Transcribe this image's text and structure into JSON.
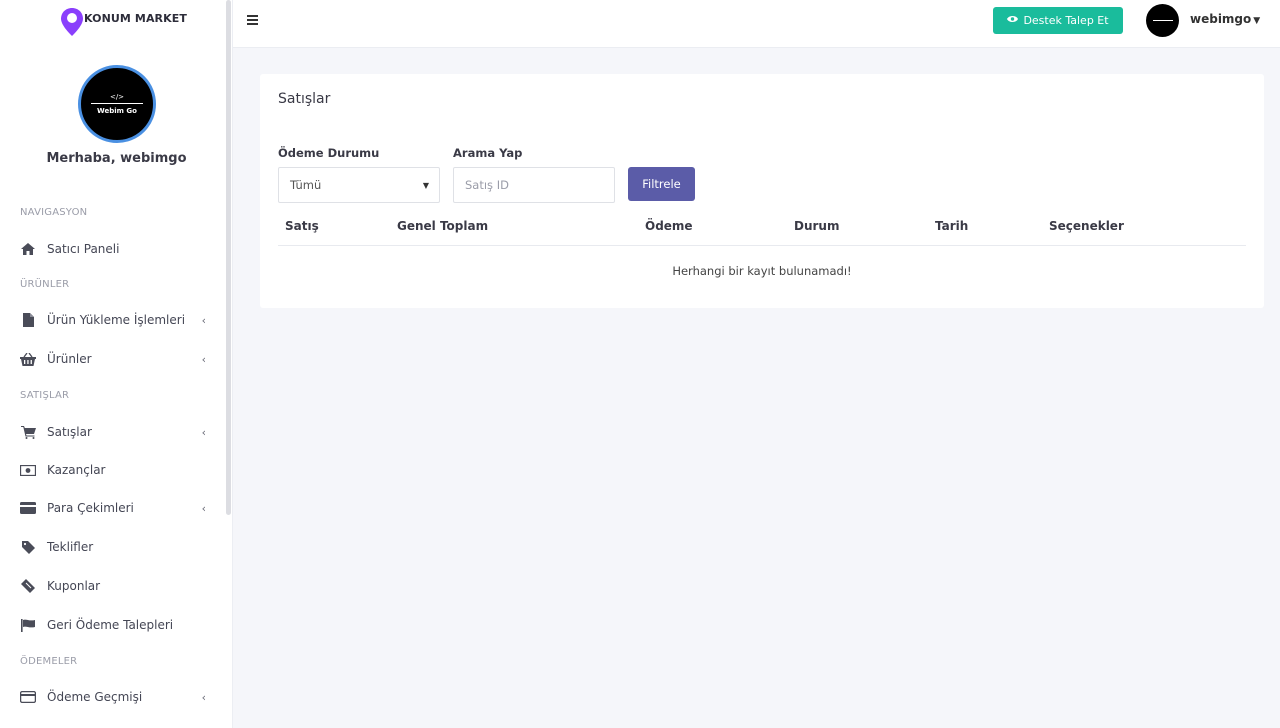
{
  "brand": {
    "logo_text": "KONUM MARKET",
    "pin_color": "#8a3ffc"
  },
  "profile": {
    "avatar_text": "Webim Go",
    "greeting": "Merhaba, webimgo"
  },
  "sidebar": {
    "sections": {
      "nav": "NAVIGASYON",
      "products": "ÜRÜNLER",
      "sales": "SATIŞLAR",
      "payments": "ÖDEMELER"
    },
    "items": {
      "dashboard": {
        "label": "Satıcı Paneli",
        "icon": "home-icon"
      },
      "upload": {
        "label": "Ürün Yükleme İşlemleri",
        "icon": "file-icon"
      },
      "products": {
        "label": "Ürünler",
        "icon": "basket-icon"
      },
      "sales": {
        "label": "Satışlar",
        "icon": "cart-icon"
      },
      "earnings": {
        "label": "Kazançlar",
        "icon": "money-icon"
      },
      "withdrawals": {
        "label": "Para Çekimleri",
        "icon": "credit-card-icon"
      },
      "offers": {
        "label": "Teklifler",
        "icon": "tag-icon"
      },
      "coupons": {
        "label": "Kuponlar",
        "icon": "ticket-icon"
      },
      "refunds": {
        "label": "Geri Ödeme Talepleri",
        "icon": "flag-icon"
      },
      "payment_history": {
        "label": "Ödeme Geçmişi",
        "icon": "credit-card-icon"
      }
    }
  },
  "topbar": {
    "support_label": "Destek Talep Et",
    "user_name": "webimgo",
    "accent": "#1abc9c"
  },
  "main": {
    "title": "Satışlar",
    "filters": {
      "payment_status_label": "Ödeme Durumu",
      "payment_status_value": "Tümü",
      "search_label": "Arama Yap",
      "search_placeholder": "Satış ID",
      "filter_button": "Filtrele",
      "button_color": "#5b5ca8"
    },
    "table": {
      "columns": [
        "Satış",
        "Genel Toplam",
        "Ödeme",
        "Durum",
        "Tarih",
        "Seçenekler"
      ],
      "empty_message": "Herhangi bir kayıt bulunamadı!"
    }
  }
}
